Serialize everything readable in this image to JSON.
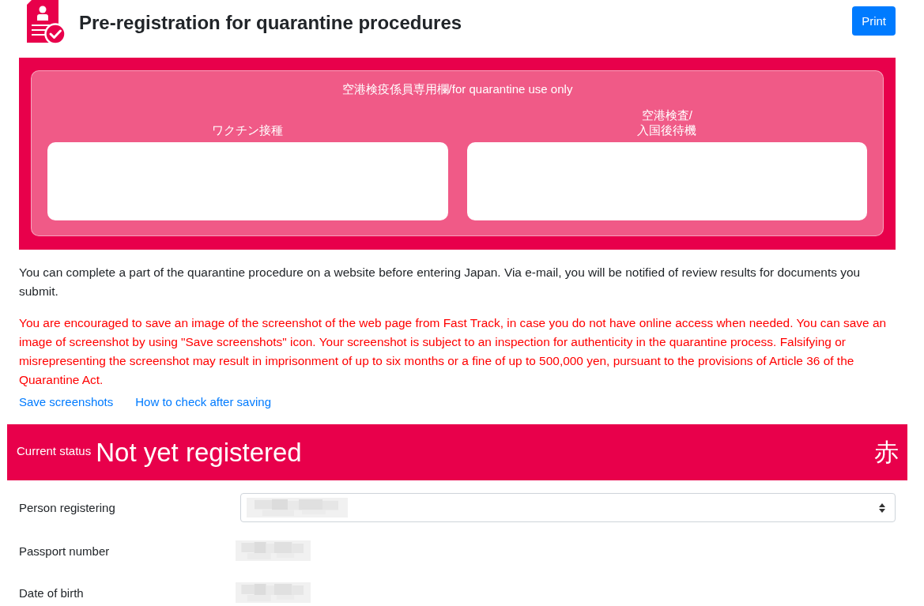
{
  "header": {
    "title": "Pre-registration for quarantine procedures",
    "print_button": "Print"
  },
  "staff_panel": {
    "title": "空港検疫係員専用欄/for quarantine use only",
    "fields": [
      {
        "label": "ワクチン接種"
      },
      {
        "label": "空港検査/\n入国後待機"
      }
    ]
  },
  "intro": "You can complete a part of the quarantine procedure on a website before entering Japan. Via e-mail, you will be notified of review results for documents you submit.",
  "notice": "You are encouraged to save an image of the screenshot of the web page from Fast Track, in case you do not have online access when needed. You can save an image of screenshot by using \"Save screenshots\" icon. Your screenshot is subject to an inspection for authenticity in the quarantine process. Falsifying or misrepresenting the screenshot may result in imprisonment of up to six months or a fine of up to 500,000 yen, pursuant to the provisions of Article 36 of the Quarantine Act.",
  "links": [
    "Save screenshots",
    "How to check after saving"
  ],
  "status": {
    "label": "Current status",
    "value": "Not yet registered",
    "code": "赤"
  },
  "form": {
    "rows": [
      {
        "label": "Person registering",
        "kind": "select"
      },
      {
        "label": "Passport number",
        "kind": "text"
      },
      {
        "label": "Date of birth",
        "kind": "text"
      }
    ]
  }
}
